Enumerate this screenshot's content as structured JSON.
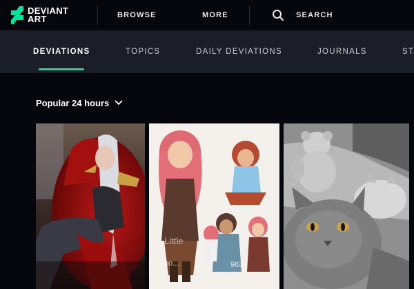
{
  "brand": {
    "line1": "DEVIANT",
    "line2": "ART",
    "accent": "#00e59b"
  },
  "topnav": {
    "browse_label": "BROWSE",
    "more_label": "MORE",
    "search_label": "SEARCH"
  },
  "tabs": [
    {
      "label": "DEVIATIONS",
      "active": true
    },
    {
      "label": "TOPICS",
      "active": false
    },
    {
      "label": "DAILY DEVIATIONS",
      "active": false
    },
    {
      "label": "JOURNALS",
      "active": false
    },
    {
      "label": "STA",
      "active": false
    }
  ],
  "feed": {
    "sort_label": "Popular 24 hours",
    "thumbs": [
      {
        "subject": "fantasy-woman-on-red-throne"
      },
      {
        "subject": "cartoon-girls-character-sheet",
        "watermark": "Little ",
        "watermark2": "oo...",
        "count": "963"
      },
      {
        "subject": "grey-cats-with-teddy-bear"
      }
    ]
  }
}
